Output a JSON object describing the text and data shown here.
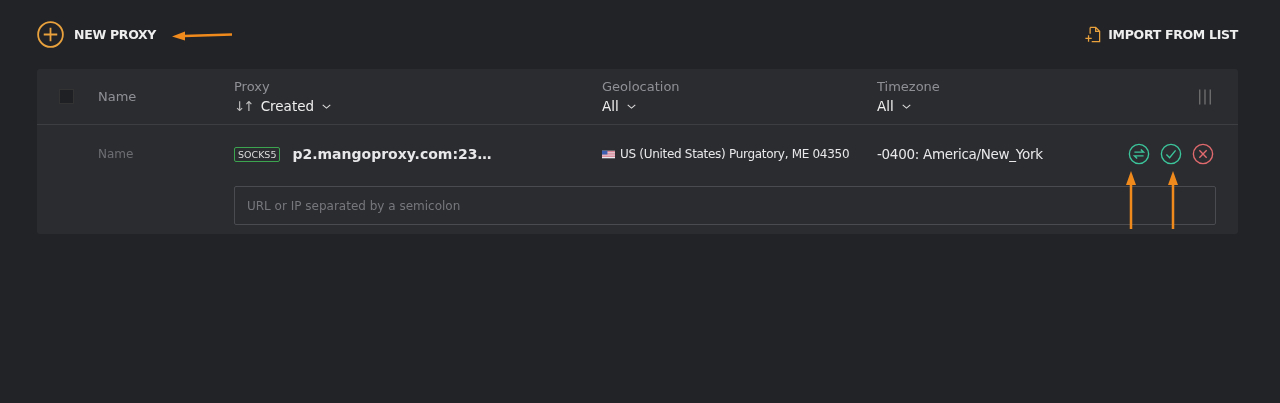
{
  "toolbar": {
    "new_proxy": "NEW PROXY",
    "import": "IMPORT FROM LIST"
  },
  "table": {
    "select_all": {
      "checked": false
    },
    "columns": [
      {
        "kind": "plain",
        "label": "Name"
      },
      {
        "kind": "sort",
        "label": "Proxy",
        "sort_arrows": "↓↑",
        "filter": "Created"
      },
      {
        "kind": "filter",
        "label": "Geolocation",
        "filter": "All"
      },
      {
        "kind": "filter",
        "label": "Timezone",
        "filter": "All"
      }
    ],
    "rows": [
      {
        "name": "Name",
        "protocol": "SOCKS5",
        "proxy": "p2.mangoproxy.com:23…",
        "geolocation": "US (United States) Purgatory, ME 04350",
        "timezone": "-0400: America/New_York",
        "input": {
          "placeholder": "URL or IP separated by a semicolon"
        }
      }
    ]
  }
}
